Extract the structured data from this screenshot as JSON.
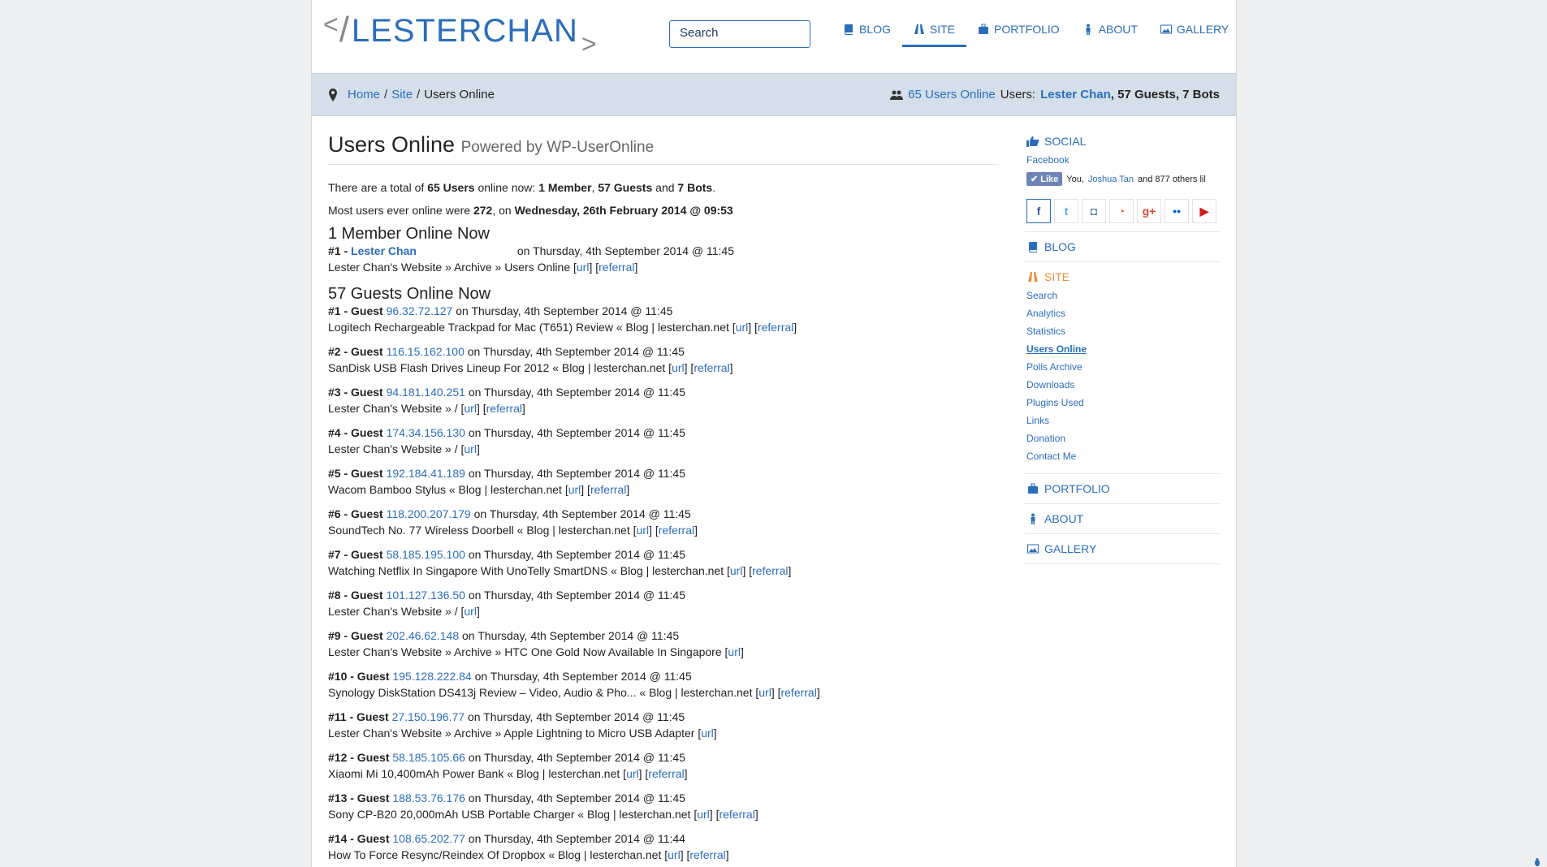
{
  "logo": {
    "lt": "<",
    "slash": "/",
    "text": "LESTERCHAN",
    "gt": ">"
  },
  "search": {
    "placeholder": "Search"
  },
  "nav": {
    "items": [
      {
        "label": "BLOG",
        "icon": "book-icon"
      },
      {
        "label": "SITE",
        "icon": "road-icon"
      },
      {
        "label": "PORTFOLIO",
        "icon": "briefcase-icon"
      },
      {
        "label": "ABOUT",
        "icon": "person-icon"
      },
      {
        "label": "GALLERY",
        "icon": "picture-icon"
      }
    ]
  },
  "breadcrumb": {
    "home": "Home",
    "site": "Site",
    "current": "Users Online",
    "sep": "/"
  },
  "online_summary": {
    "count_link": "65 Users Online",
    "users_label": "Users:",
    "member": "Lester Chan",
    "rest": ", 57 Guests, 7 Bots"
  },
  "main": {
    "title": "Users Online",
    "subtitle": "Powered by WP-UserOnline",
    "total_pre": "There are a total of",
    "total_users": "65 Users",
    "total_mid": "online now:",
    "total_member": "1 Member",
    "total_guests": "57 Guests",
    "total_and": "and",
    "total_bots": "7 Bots",
    "most_pre": "Most users ever online were",
    "most_count": "272",
    "most_mid": ", on",
    "most_date": "Wednesday, 26th February 2014 @ 09:53",
    "members_heading": "1 Member Online Now",
    "member_entry": {
      "num": "#1 -",
      "name": "Lester Chan",
      "time": "on Thursday, 4th September 2014 @ 11:45",
      "location": "Lester Chan's Website » Archive » Users Online",
      "url": "url",
      "referral": "referral"
    },
    "guests_heading": "57 Guests Online Now",
    "guests": [
      {
        "num": "#1 - Guest",
        "ip": "96.32.72.127",
        "time": "on Thursday, 4th September 2014 @ 11:45",
        "location": "Logitech Rechargeable Trackpad for Mac (T651) Review « Blog | lesterchan.net",
        "url": "url",
        "referral": "referral"
      },
      {
        "num": "#2 - Guest",
        "ip": "116.15.162.100",
        "time": "on Thursday, 4th September 2014 @ 11:45",
        "location": "SanDisk USB Flash Drives Lineup For 2012 « Blog | lesterchan.net",
        "url": "url",
        "referral": "referral"
      },
      {
        "num": "#3 - Guest",
        "ip": "94.181.140.251",
        "time": "on Thursday, 4th September 2014 @ 11:45",
        "location": "Lester Chan's Website » /",
        "url": "url",
        "referral": "referral"
      },
      {
        "num": "#4 - Guest",
        "ip": "174.34.156.130",
        "time": "on Thursday, 4th September 2014 @ 11:45",
        "location": "Lester Chan's Website » /",
        "url": "url",
        "referral": ""
      },
      {
        "num": "#5 - Guest",
        "ip": "192.184.41.189",
        "time": "on Thursday, 4th September 2014 @ 11:45",
        "location": "Wacom Bamboo Stylus « Blog | lesterchan.net",
        "url": "url",
        "referral": "referral"
      },
      {
        "num": "#6 - Guest",
        "ip": "118.200.207.179",
        "time": "on Thursday, 4th September 2014 @ 11:45",
        "location": "SoundTech No. 77 Wireless Doorbell « Blog | lesterchan.net",
        "url": "url",
        "referral": "referral"
      },
      {
        "num": "#7 - Guest",
        "ip": "58.185.195.100",
        "time": "on Thursday, 4th September 2014 @ 11:45",
        "location": "Watching Netflix In Singapore With UnoTelly SmartDNS « Blog | lesterchan.net",
        "url": "url",
        "referral": "referral"
      },
      {
        "num": "#8 - Guest",
        "ip": "101.127.136.50",
        "time": "on Thursday, 4th September 2014 @ 11:45",
        "location": "Lester Chan's Website » /",
        "url": "url",
        "referral": ""
      },
      {
        "num": "#9 - Guest",
        "ip": "202.46.62.148",
        "time": "on Thursday, 4th September 2014 @ 11:45",
        "location": "Lester Chan's Website » Archive » HTC One Gold Now Available In Singapore",
        "url": "url",
        "referral": ""
      },
      {
        "num": "#10 - Guest",
        "ip": "195.128.222.84",
        "time": "on Thursday, 4th September 2014 @ 11:45",
        "location": "Synology DiskStation DS413j Review – Video, Audio & Pho... « Blog | lesterchan.net",
        "url": "url",
        "referral": "referral"
      },
      {
        "num": "#11 - Guest",
        "ip": "27.150.196.77",
        "time": "on Thursday, 4th September 2014 @ 11:45",
        "location": "Lester Chan's Website » Archive » Apple Lightning to Micro USB Adapter",
        "url": "url",
        "referral": ""
      },
      {
        "num": "#12 - Guest",
        "ip": "58.185.105.66",
        "time": "on Thursday, 4th September 2014 @ 11:45",
        "location": "Xiaomi Mi 10,400mAh Power Bank « Blog | lesterchan.net",
        "url": "url",
        "referral": "referral"
      },
      {
        "num": "#13 - Guest",
        "ip": "188.53.76.176",
        "time": "on Thursday, 4th September 2014 @ 11:45",
        "location": "Sony CP-B20 20,000mAh USB Portable Charger « Blog | lesterchan.net",
        "url": "url",
        "referral": "referral"
      },
      {
        "num": "#14 - Guest",
        "ip": "108.65.202.77",
        "time": "on Thursday, 4th September 2014 @ 11:44",
        "location": "How To Force Resync/Reindex Of Dropbox « Blog | lesterchan.net",
        "url": "url",
        "referral": "referral"
      }
    ]
  },
  "sidebar": {
    "social": {
      "heading": "SOCIAL",
      "facebook": "Facebook",
      "like_label": "Like",
      "like_text_pre": "You,",
      "like_friend": "Joshua Tan",
      "like_text_post": "and 877 others lil",
      "icons": [
        {
          "name": "facebook-icon",
          "glyph": "f",
          "color": "#3b5998"
        },
        {
          "name": "twitter-icon",
          "glyph": "t",
          "color": "#55acee"
        },
        {
          "name": "instagram-icon",
          "glyph": "◘",
          "color": "#517fa4"
        },
        {
          "name": "rss-icon",
          "glyph": "◔",
          "color": "#f26522"
        },
        {
          "name": "googleplus-icon",
          "glyph": "g+",
          "color": "#dd4b39"
        },
        {
          "name": "flickr-icon",
          "glyph": "••",
          "color": "#0063dc"
        },
        {
          "name": "youtube-icon",
          "glyph": "▶",
          "color": "#cd201f"
        }
      ]
    },
    "blog": "BLOG",
    "site": {
      "heading": "SITE",
      "links": [
        "Search",
        "Analytics",
        "Statistics",
        "Users Online",
        "Polls Archive",
        "Downloads",
        "Plugins Used",
        "Links",
        "Donation",
        "Contact Me"
      ],
      "current_index": 3
    },
    "portfolio": "PORTFOLIO",
    "about": "ABOUT",
    "gallery": "GALLERY"
  },
  "colors": {
    "accent": "#2a6ebb",
    "site_orange": "#e8913a",
    "breadcrumb_bg": "#d4dfe9"
  }
}
